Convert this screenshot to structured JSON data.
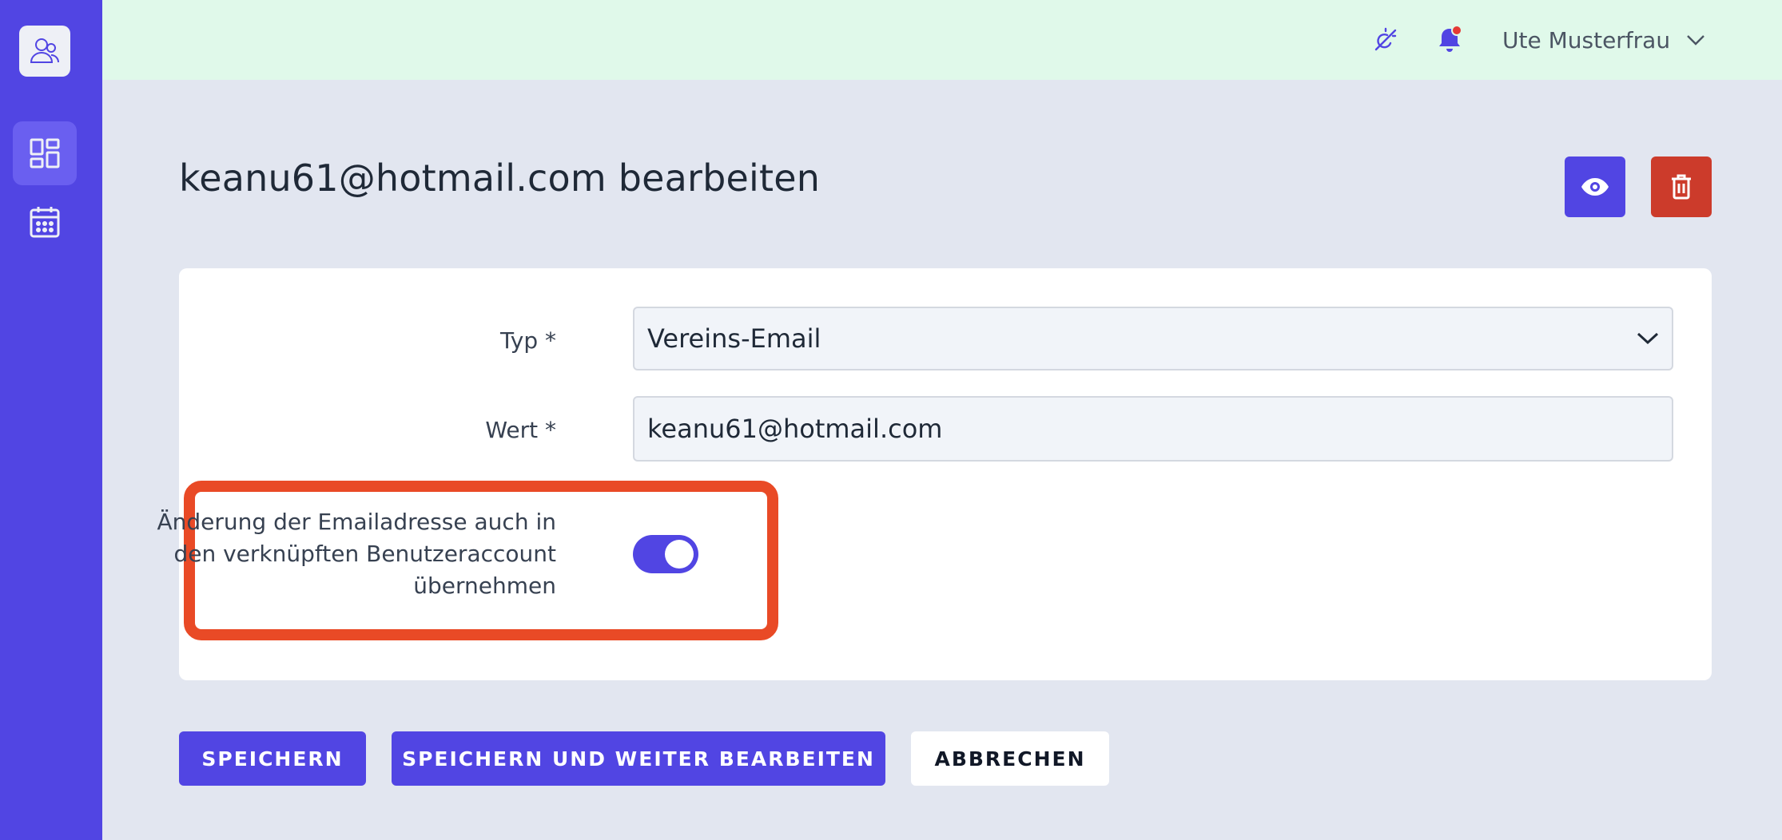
{
  "topbar": {
    "user_name": "Ute Musterfrau",
    "notification_dot_color": "#e53935"
  },
  "page": {
    "title": "keanu61@hotmail.com bearbeiten"
  },
  "form": {
    "typ_label": "Typ *",
    "typ_value": "Vereins-Email",
    "wert_label": "Wert *",
    "wert_value": "keanu61@hotmail.com",
    "toggle_label": "Änderung der Emailadresse auch in den verknüpften Benutzeraccount übernehmen",
    "toggle_on": true
  },
  "actions": {
    "save_label": "SPEICHERN",
    "save_continue_label": "SPEICHERN UND WEITER BEARBEITEN",
    "cancel_label": "ABBRECHEN"
  },
  "icons": {
    "logo": "user-group-icon",
    "dashboard": "dashboard-icon",
    "calendar": "calendar-icon",
    "theme": "theme-toggle-icon",
    "notifications": "bell-icon",
    "view": "eye-icon",
    "delete": "trash-icon"
  },
  "colors": {
    "primary": "#5145e3",
    "danger": "#cc3b2b",
    "highlight": "#e94a26"
  }
}
